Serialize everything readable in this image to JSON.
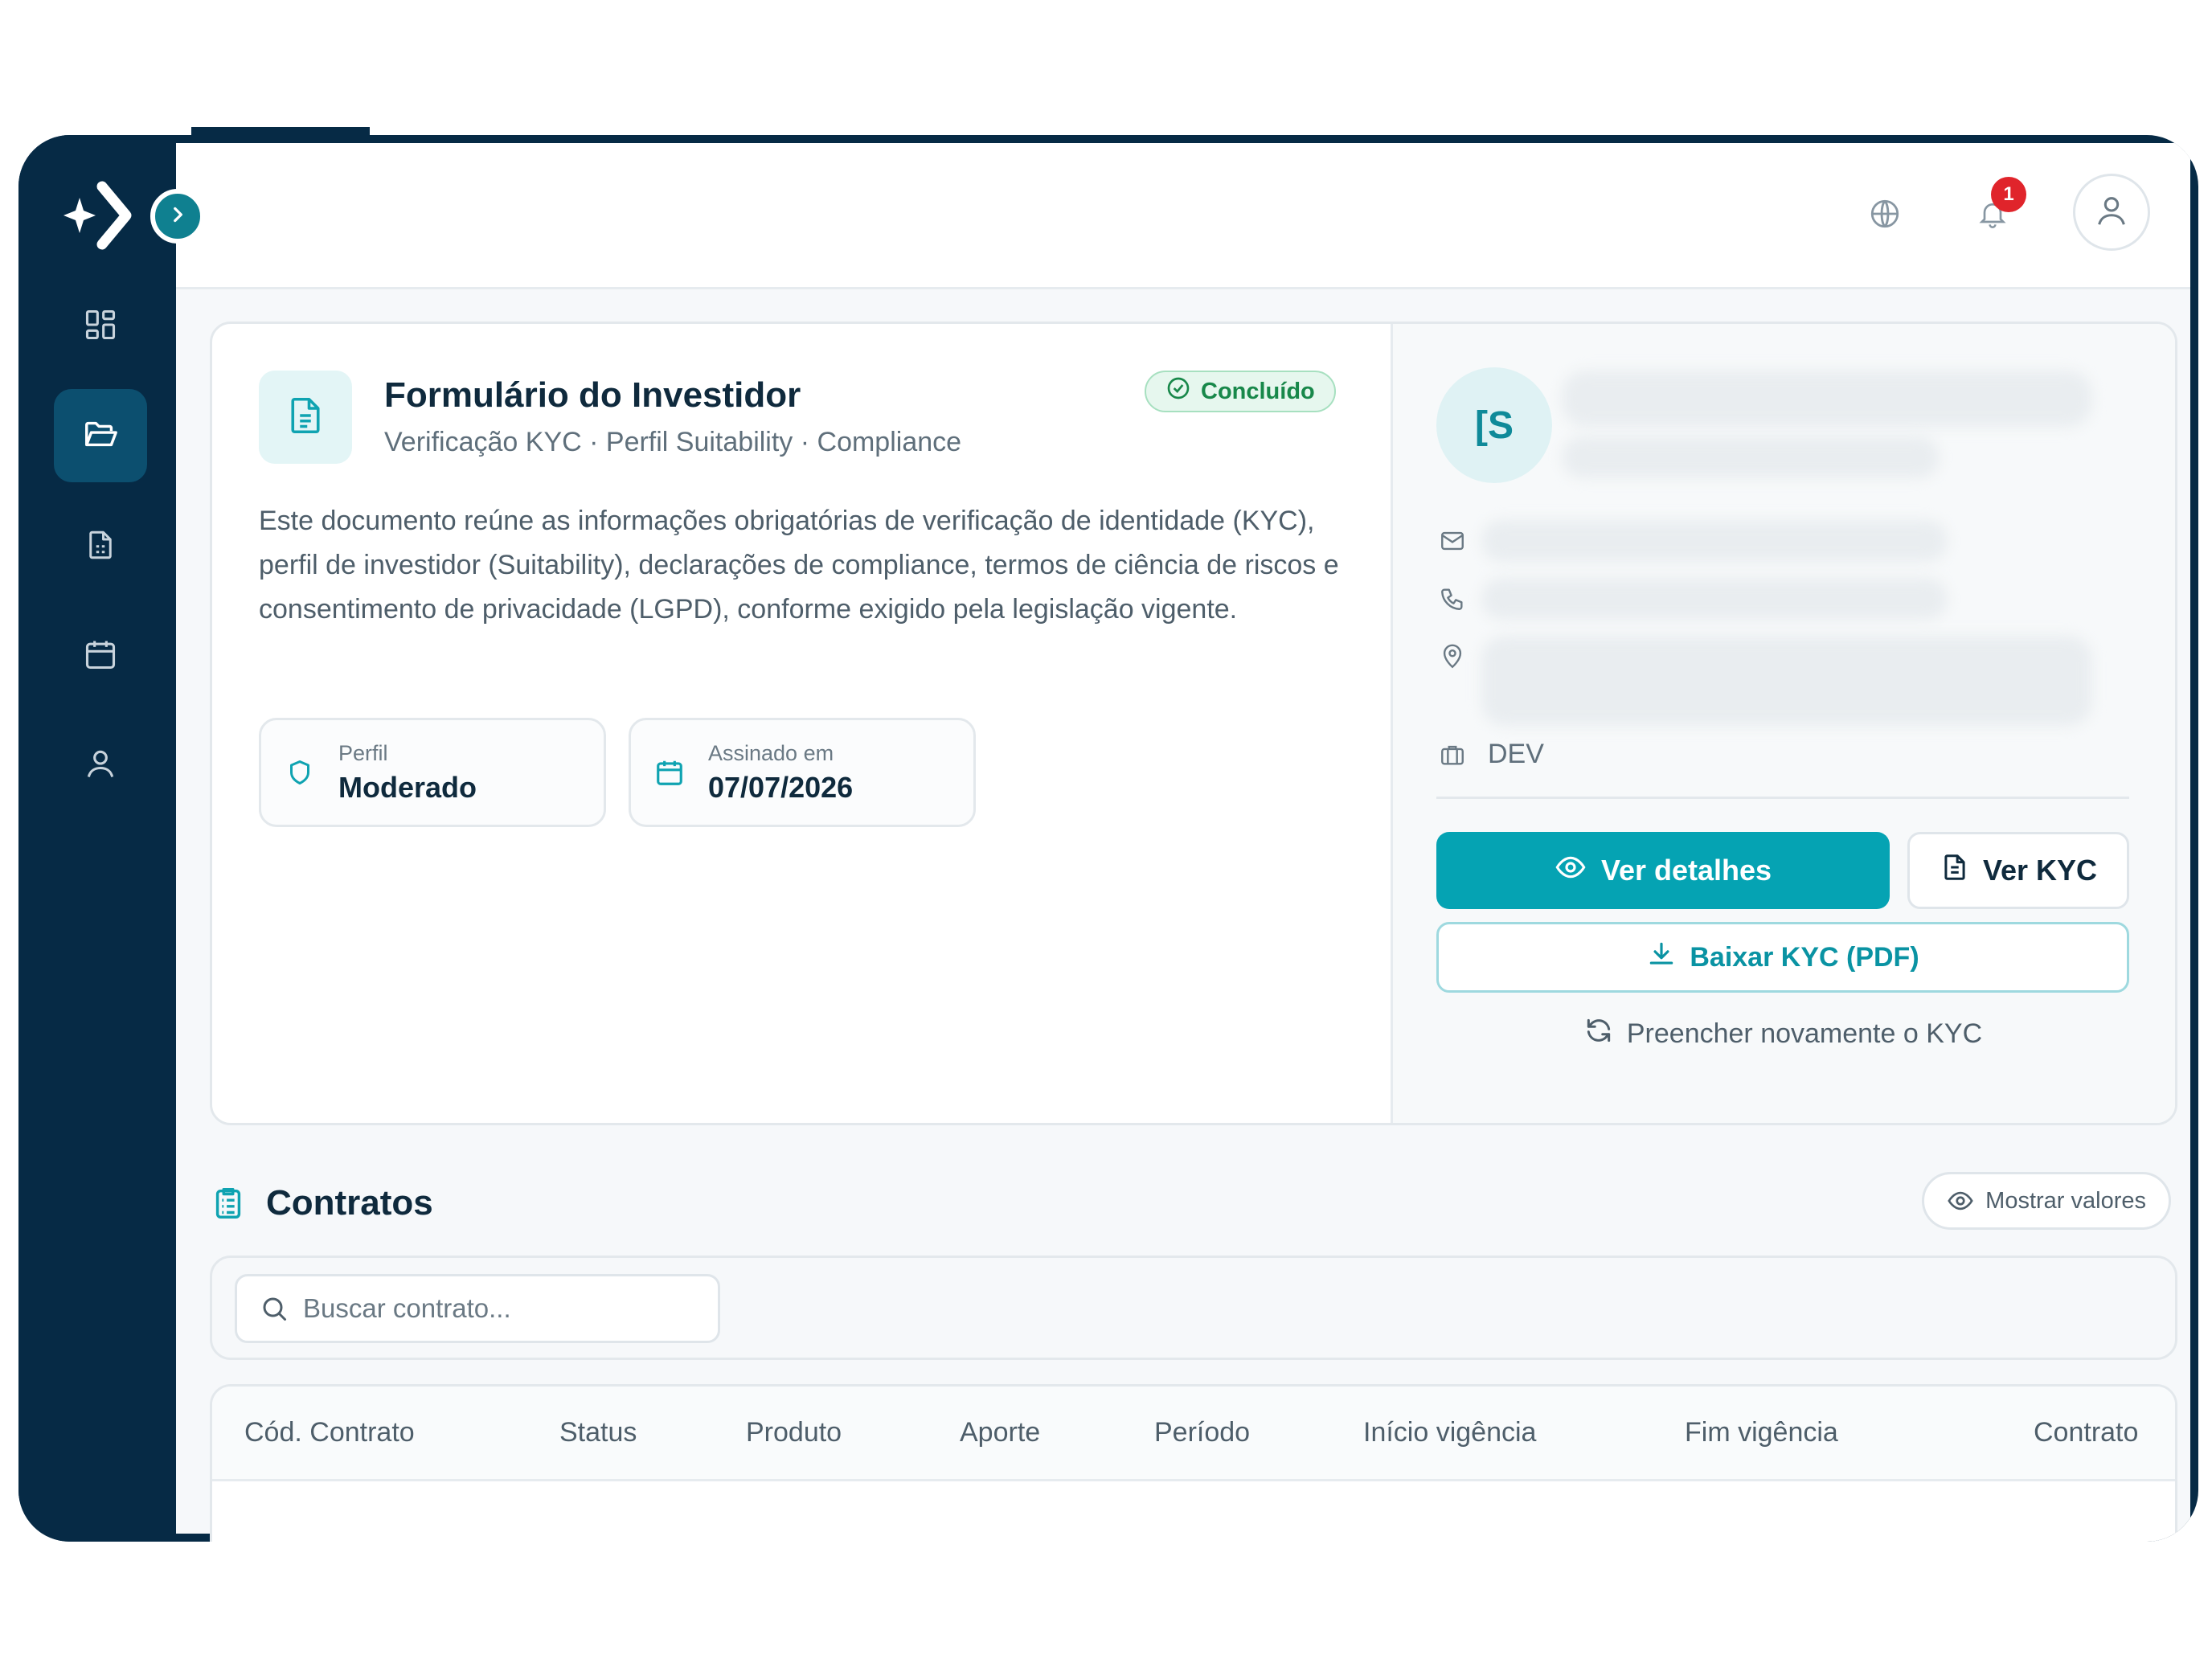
{
  "header": {
    "notification_count": "1"
  },
  "kyc_card": {
    "title": "Formulário do Investidor",
    "subtitle": "Verificação KYC · Perfil Suitability · Compliance",
    "status": "Concluído",
    "description": "Este documento reúne as informações obrigatórias de verificação de identidade (KYC), perfil de investidor (Suitability), declarações de compliance, termos de ciência de riscos e consentimento de privacidade (LGPD), conforme exigido pela legislação vigente.",
    "profile": {
      "label": "Perfil",
      "value": "Moderado"
    },
    "signed": {
      "label": "Assinado em",
      "value": "07/07/2026"
    }
  },
  "client": {
    "initials": "[S",
    "department": "DEV",
    "details_button": "Ver detalhes",
    "kyc_button": "Ver KYC",
    "download_button": "Baixar KYC (PDF)",
    "refill_button": "Preencher novamente o KYC"
  },
  "contracts": {
    "title": "Contratos",
    "show_values": "Mostrar valores",
    "search_placeholder": "Buscar contrato...",
    "columns": [
      "Cód. Contrato",
      "Status",
      "Produto",
      "Aporte",
      "Período",
      "Início vigência",
      "Fim vigência",
      "Contrato"
    ]
  },
  "colors": {
    "sidebar": "#062a45",
    "accent": "#05a3b3",
    "success": "#18884a",
    "badge": "#e0242b"
  },
  "icons": {
    "logo": "sparkle-chevron-logo",
    "nav": [
      "dashboard-icon",
      "folder-icon",
      "document-icon",
      "calendar-icon",
      "user-icon"
    ],
    "topbar": [
      "globe-icon",
      "bell-icon",
      "user-icon"
    ]
  }
}
